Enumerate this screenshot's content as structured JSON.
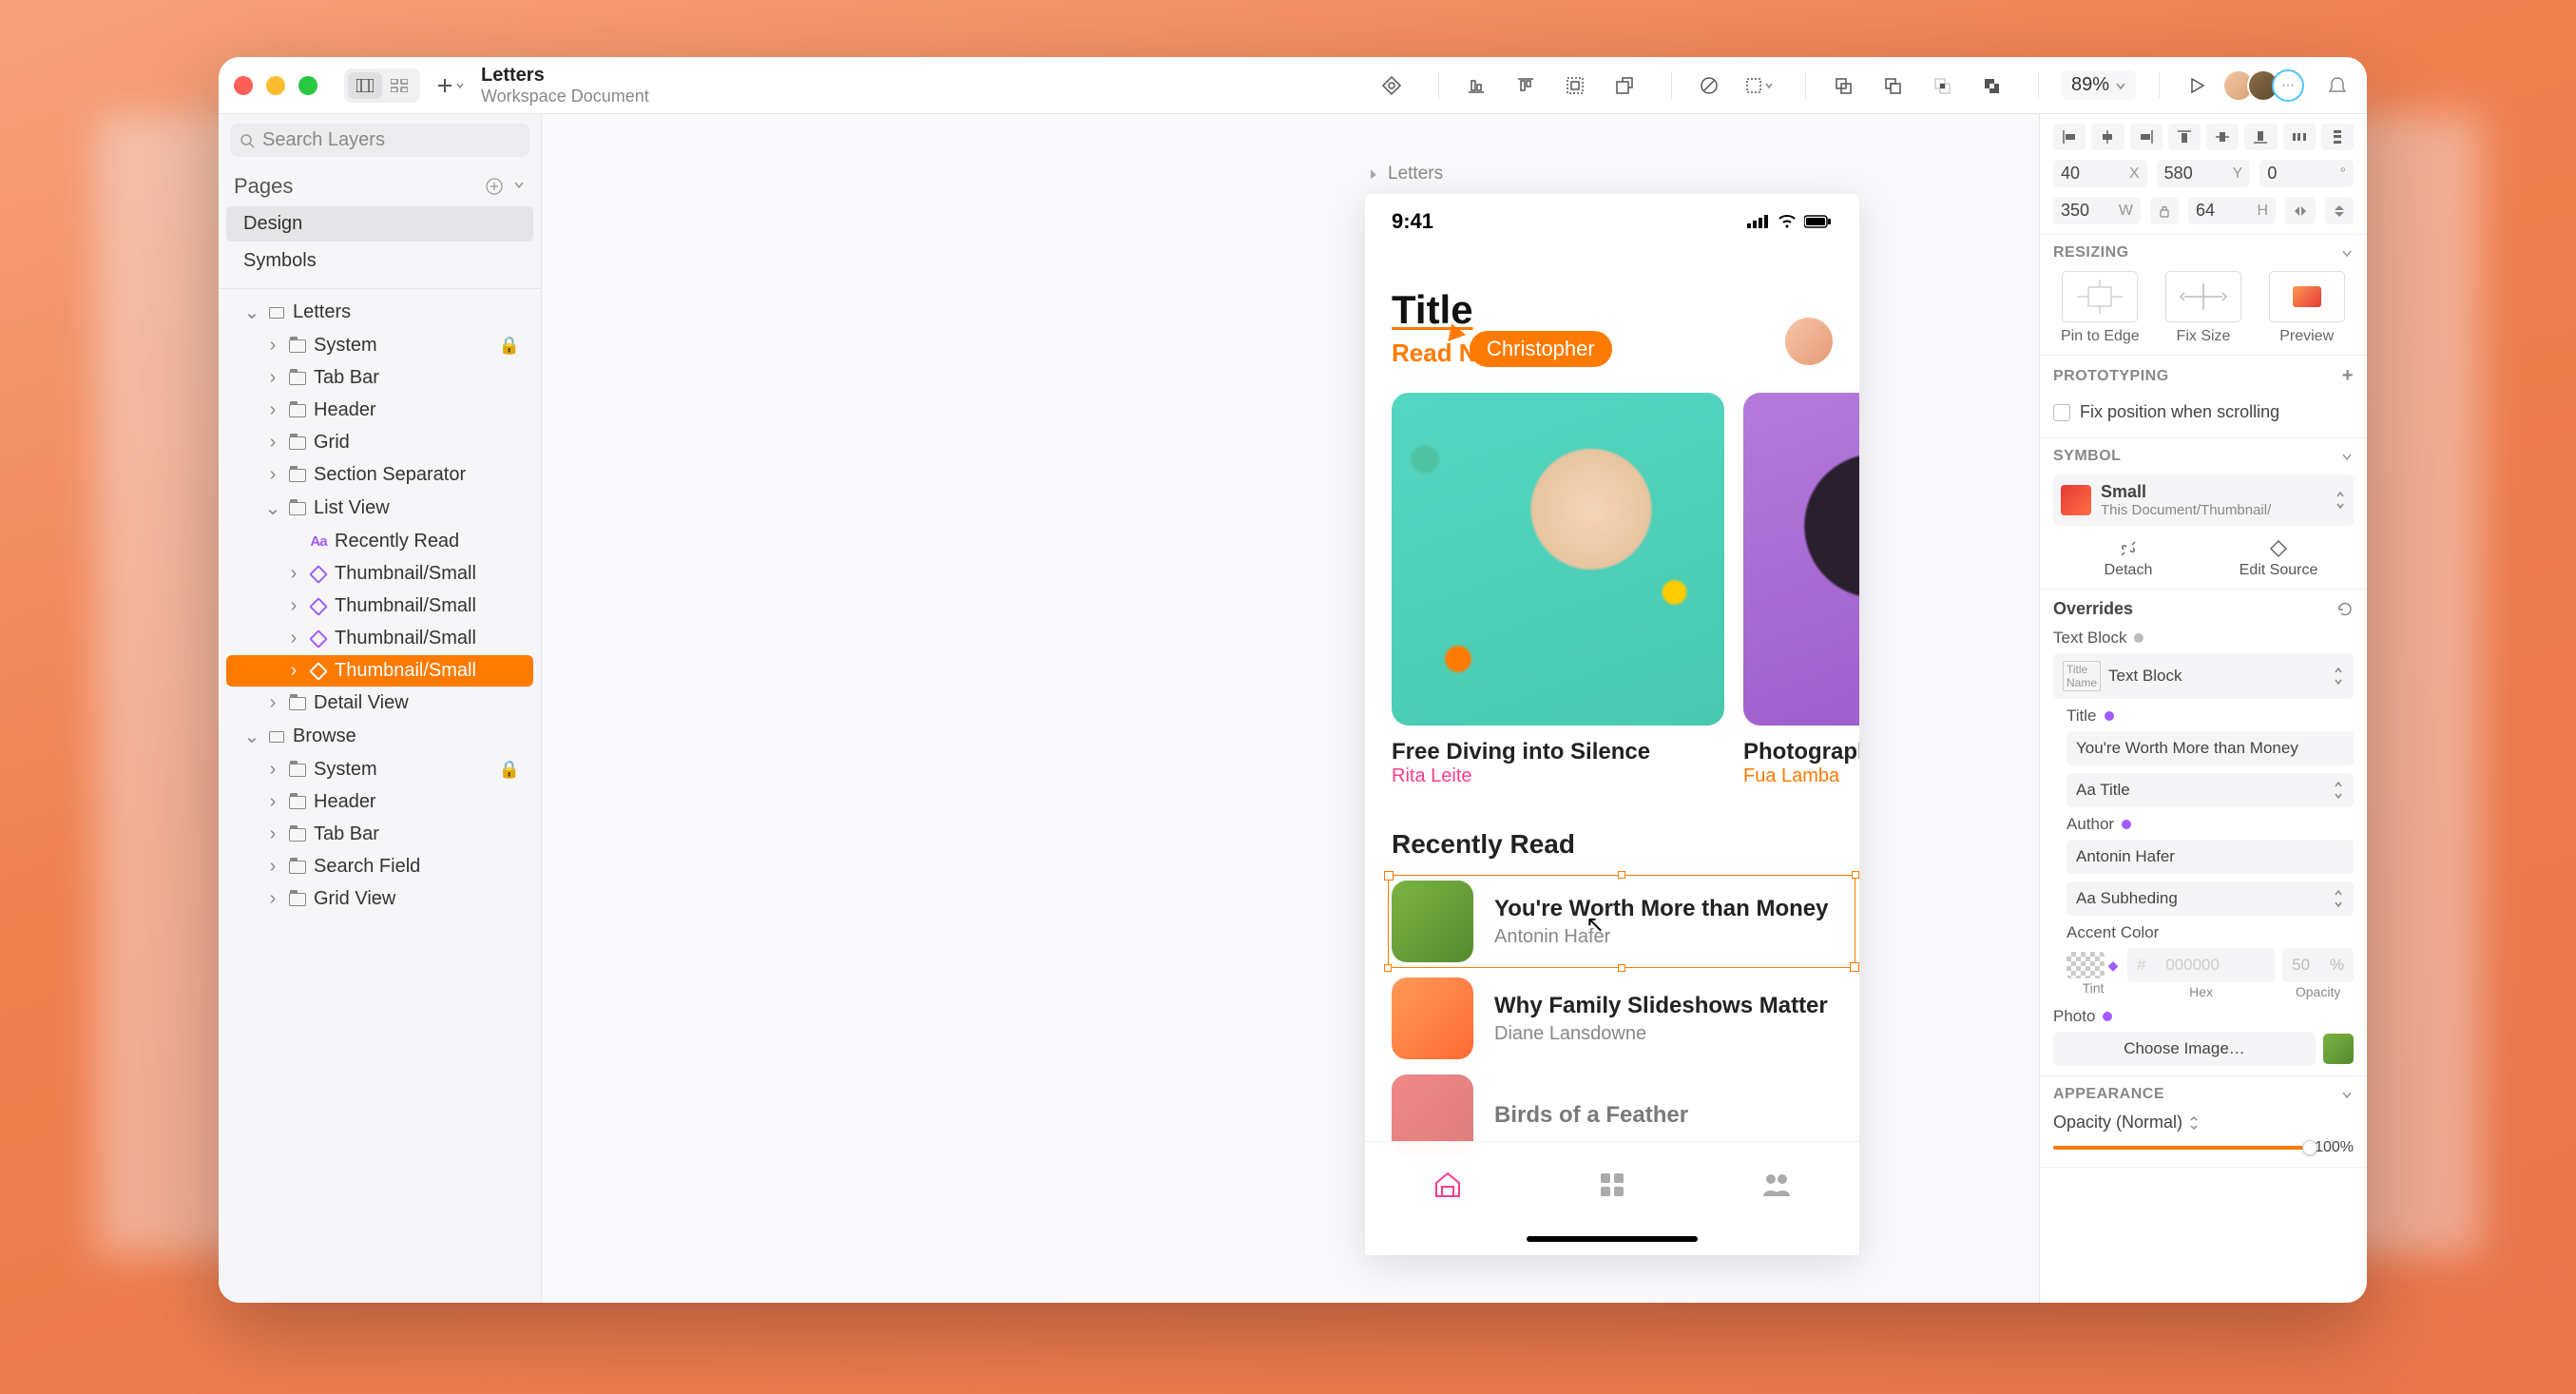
{
  "doc": {
    "title": "Letters",
    "subtitle": "Workspace Document"
  },
  "toolbar": {
    "zoom": "89%"
  },
  "sidebar": {
    "search_placeholder": "Search Layers",
    "pages_heading": "Pages",
    "pages": [
      {
        "label": "Design",
        "active": true
      },
      {
        "label": "Symbols",
        "active": false
      }
    ],
    "layers": [
      {
        "label": "Letters",
        "type": "artboard",
        "indent": 1,
        "expanded": true
      },
      {
        "label": "System",
        "type": "folder",
        "indent": 2,
        "locked": true
      },
      {
        "label": "Tab Bar",
        "type": "folder",
        "indent": 2
      },
      {
        "label": "Header",
        "type": "folder",
        "indent": 2
      },
      {
        "label": "Grid",
        "type": "folder",
        "indent": 2
      },
      {
        "label": "Section Separator",
        "type": "folder",
        "indent": 2
      },
      {
        "label": "List View",
        "type": "folder",
        "indent": 2,
        "expanded": true
      },
      {
        "label": "Recently Read",
        "type": "text",
        "indent": 3
      },
      {
        "label": "Thumbnail/Small",
        "type": "symbol",
        "indent": 3
      },
      {
        "label": "Thumbnail/Small",
        "type": "symbol",
        "indent": 3
      },
      {
        "label": "Thumbnail/Small",
        "type": "symbol",
        "indent": 3
      },
      {
        "label": "Thumbnail/Small",
        "type": "symbol",
        "indent": 3,
        "selected": true
      },
      {
        "label": "Detail View",
        "type": "folder",
        "indent": 2
      },
      {
        "label": "Browse",
        "type": "artboard",
        "indent": 1,
        "expanded": true
      },
      {
        "label": "System",
        "type": "folder",
        "indent": 2,
        "locked": true
      },
      {
        "label": "Header",
        "type": "folder",
        "indent": 2
      },
      {
        "label": "Tab Bar",
        "type": "folder",
        "indent": 2
      },
      {
        "label": "Search Field",
        "type": "folder",
        "indent": 2
      },
      {
        "label": "Grid View",
        "type": "folder",
        "indent": 2
      }
    ]
  },
  "canvas": {
    "artboard_label": "Letters",
    "status_time": "9:41",
    "collaborator_name": "Christopher",
    "title": "Title",
    "read_now": "Read Now",
    "cards": [
      {
        "title": "Free Diving into Silence",
        "author": "Rita Leite"
      },
      {
        "title": "Photographi",
        "author": "Fua Lamba"
      }
    ],
    "section_heading": "Recently Read",
    "list": [
      {
        "title": "You're Worth More than Money",
        "author": "Antonin Hafer",
        "selected": true
      },
      {
        "title": "Why Family Slideshows Matter",
        "author": "Diane Lansdowne"
      },
      {
        "title": "Birds of a Feather",
        "author": ""
      }
    ]
  },
  "inspector": {
    "x": "40",
    "y": "580",
    "rotation": "0",
    "w": "350",
    "h": "64",
    "resizing_heading": "RESIZING",
    "resize": {
      "pin": "Pin to Edge",
      "fix": "Fix Size",
      "preview": "Preview"
    },
    "prototyping_heading": "PROTOTYPING",
    "proto_fix": "Fix position when scrolling",
    "symbol_heading": "SYMBOL",
    "symbol": {
      "name": "Small",
      "path": "This Document/Thumbnail/",
      "detach": "Detach",
      "edit": "Edit Source"
    },
    "overrides_heading": "Overrides",
    "overrides": {
      "text_block_label": "Text Block",
      "text_block_value": "Text Block",
      "title_label": "Title",
      "title_value": "You're Worth More than Money",
      "title_style": "Aa Title",
      "author_label": "Author",
      "author_value": "Antonin Hafer",
      "author_style": "Aa Subheding",
      "accent_label": "Accent Color",
      "hex_placeholder": "000000",
      "opacity_val": "50",
      "opacity_unit": "%",
      "tint_label": "Tint",
      "hex_label": "Hex",
      "opacity_label": "Opacity",
      "photo_label": "Photo",
      "choose_image": "Choose Image…"
    },
    "appearance_heading": "APPEARANCE",
    "opacity_mode": "Opacity (Normal)",
    "opacity_value": "100%"
  }
}
